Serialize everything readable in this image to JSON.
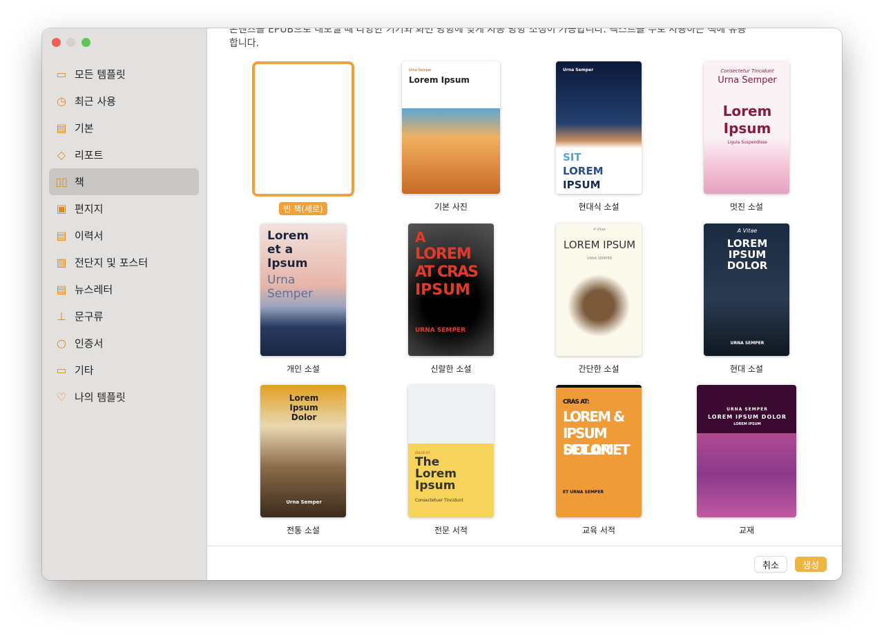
{
  "window": {
    "controls": [
      "close",
      "minimize",
      "zoom"
    ]
  },
  "sidebar": {
    "items": [
      {
        "label": "모든 템플릿",
        "icon": "grid-icon",
        "glyph": "▭"
      },
      {
        "label": "최근 사용",
        "icon": "clock-icon",
        "glyph": "◷"
      },
      {
        "label": "기본",
        "icon": "document-icon",
        "glyph": "▤"
      },
      {
        "label": "리포트",
        "icon": "graduation-cap-icon",
        "glyph": "◇"
      },
      {
        "label": "책",
        "icon": "book-icon",
        "glyph": "▯▯",
        "selected": true
      },
      {
        "label": "편지지",
        "icon": "stamp-frame-icon",
        "glyph": "▣"
      },
      {
        "label": "이력서",
        "icon": "resume-icon",
        "glyph": "▤"
      },
      {
        "label": "전단지 및 포스터",
        "icon": "map-icon",
        "glyph": "▥"
      },
      {
        "label": "뉴스레터",
        "icon": "newspaper-icon",
        "glyph": "▤"
      },
      {
        "label": "문구류",
        "icon": "stamp-icon",
        "glyph": "⊥"
      },
      {
        "label": "인증서",
        "icon": "award-icon",
        "glyph": "○"
      },
      {
        "label": "기타",
        "icon": "archive-box-icon",
        "glyph": "▭"
      },
      {
        "label": "나의 템플릿",
        "icon": "heart-icon",
        "glyph": "♡"
      }
    ]
  },
  "main": {
    "description": "콘텐츠를 EPUB으로 내보낼 때 다양한 기기와 화면 방향에 맞게 자동 방향 조정이 가능합니다. 텍스트를 주로 사용하는 책에 유용합니다.",
    "templates": [
      {
        "label": "빈 책(세로)",
        "selected": true,
        "lines": []
      },
      {
        "label": "기본 사진",
        "lines": [
          "Urna Semper",
          "Lorem Ipsum"
        ]
      },
      {
        "label": "현대식 소설",
        "lines": [
          "Urna Semper",
          "SIT",
          "LOREM",
          "IPSUM"
        ]
      },
      {
        "label": "멋진 소설",
        "lines": [
          "Consectetur Tincidunt",
          "Urna Semper",
          "Lorem",
          "Ipsum",
          "Ligula Suspendisse"
        ]
      },
      {
        "label": "개인 소설",
        "lines": [
          "Lorem",
          "et a",
          "Ipsum",
          "Urna",
          "Semper"
        ]
      },
      {
        "label": "신랄한 소설",
        "lines": [
          "A",
          "LOREM",
          "AT CRAS",
          "IPSUM",
          "URNA SEMPER"
        ]
      },
      {
        "label": "간단한 소설",
        "lines": [
          "A Vitae",
          "LOREM IPSUM",
          "URNA SEMPER"
        ]
      },
      {
        "label": "현대 소설",
        "lines": [
          "A Vitae",
          "LOREM",
          "IPSUM",
          "DOLOR",
          "URNA SEMPER"
        ]
      },
      {
        "label": "전통 소설",
        "lines": [
          "Lorem",
          "Ipsum",
          "Dolor",
          "Urna Semper"
        ]
      },
      {
        "label": "전문 서적",
        "lines": [
          "DOLOR SIT",
          "The",
          "Lorem",
          "Ipsum",
          "Consectetuer Tincidunt"
        ]
      },
      {
        "label": "교육 서적",
        "lines": [
          "CRAS AT:",
          "LOREM &",
          "IPSUM DOLOR",
          "SET AMET",
          "ET URNA SEMPER"
        ]
      },
      {
        "label": "교재",
        "lines": [
          "URNA SEMPER",
          "LOREM IPSUM DOLOR",
          "LOREM IPSUM"
        ]
      }
    ]
  },
  "footer": {
    "cancel": "취소",
    "create": "생성"
  },
  "colors": {
    "accent": "#f0a23a",
    "sidebar": "#e3e1df"
  }
}
